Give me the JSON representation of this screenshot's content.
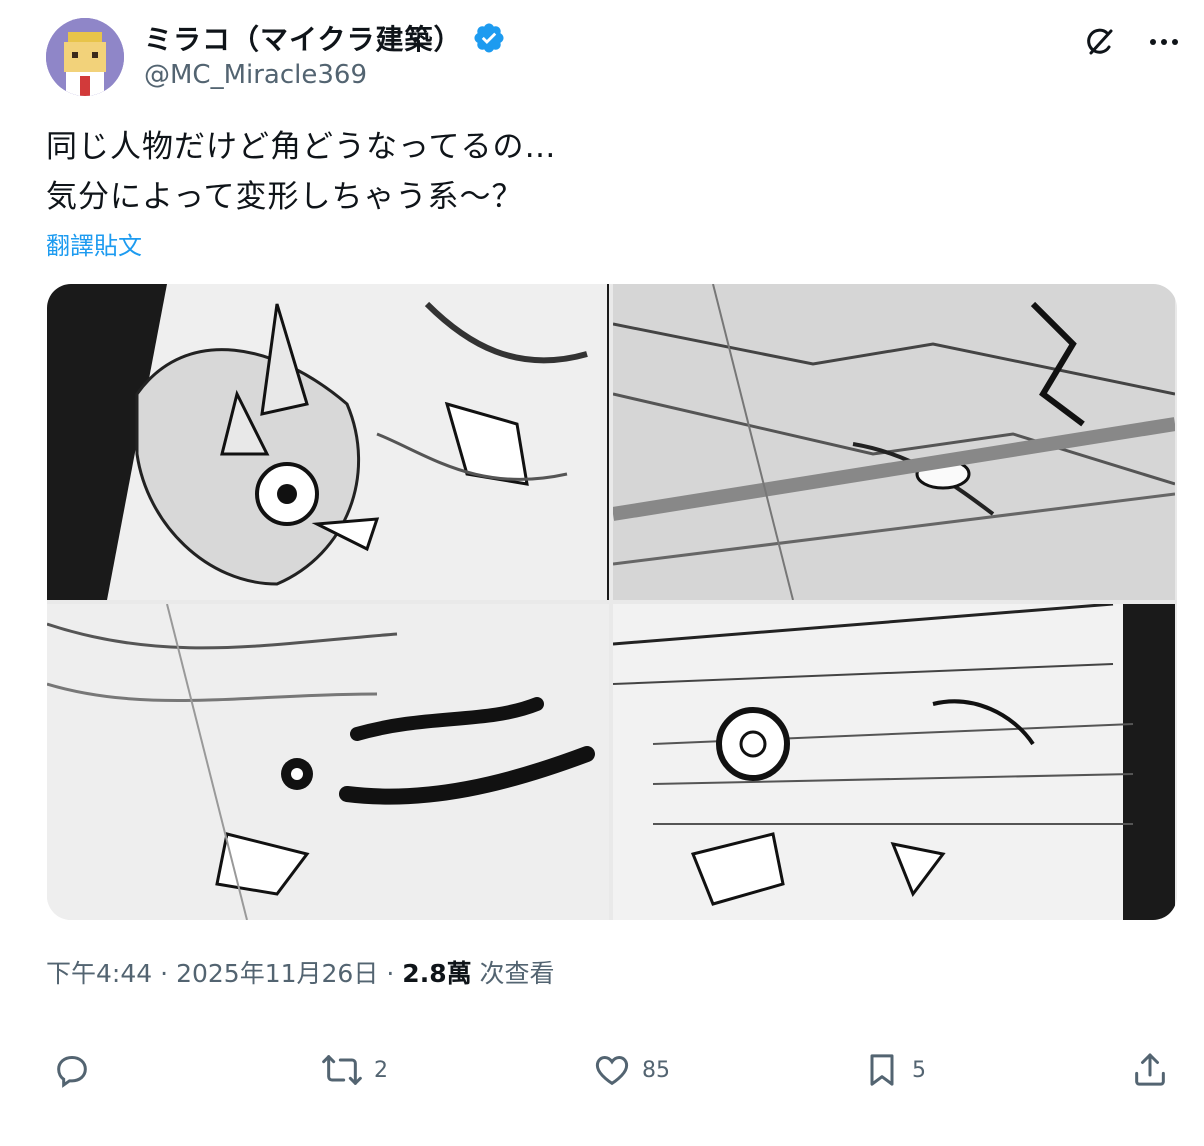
{
  "author": {
    "display_name": "ミラコ（マイクラ建築）",
    "handle": "@MC_Miracle369",
    "verified": true,
    "accent": "#1d9bf0"
  },
  "tweet": {
    "lines": [
      "同じ人物だけど角どうなってるの…",
      "気分によって変形しちゃう系〜？"
    ],
    "translate_label": "翻譯貼文"
  },
  "media": {
    "images": [
      {
        "icon": "manga-panel-image"
      },
      {
        "icon": "manga-panel-image"
      },
      {
        "icon": "manga-panel-image"
      },
      {
        "icon": "manga-panel-image"
      }
    ]
  },
  "meta": {
    "time": "下午4:44",
    "date": "2025年11月26日",
    "views_count": "2.8萬",
    "views_label": "次查看"
  },
  "actions": {
    "reply_count": "",
    "repost_count": "2",
    "like_count": "85",
    "bookmark_count": "5"
  }
}
